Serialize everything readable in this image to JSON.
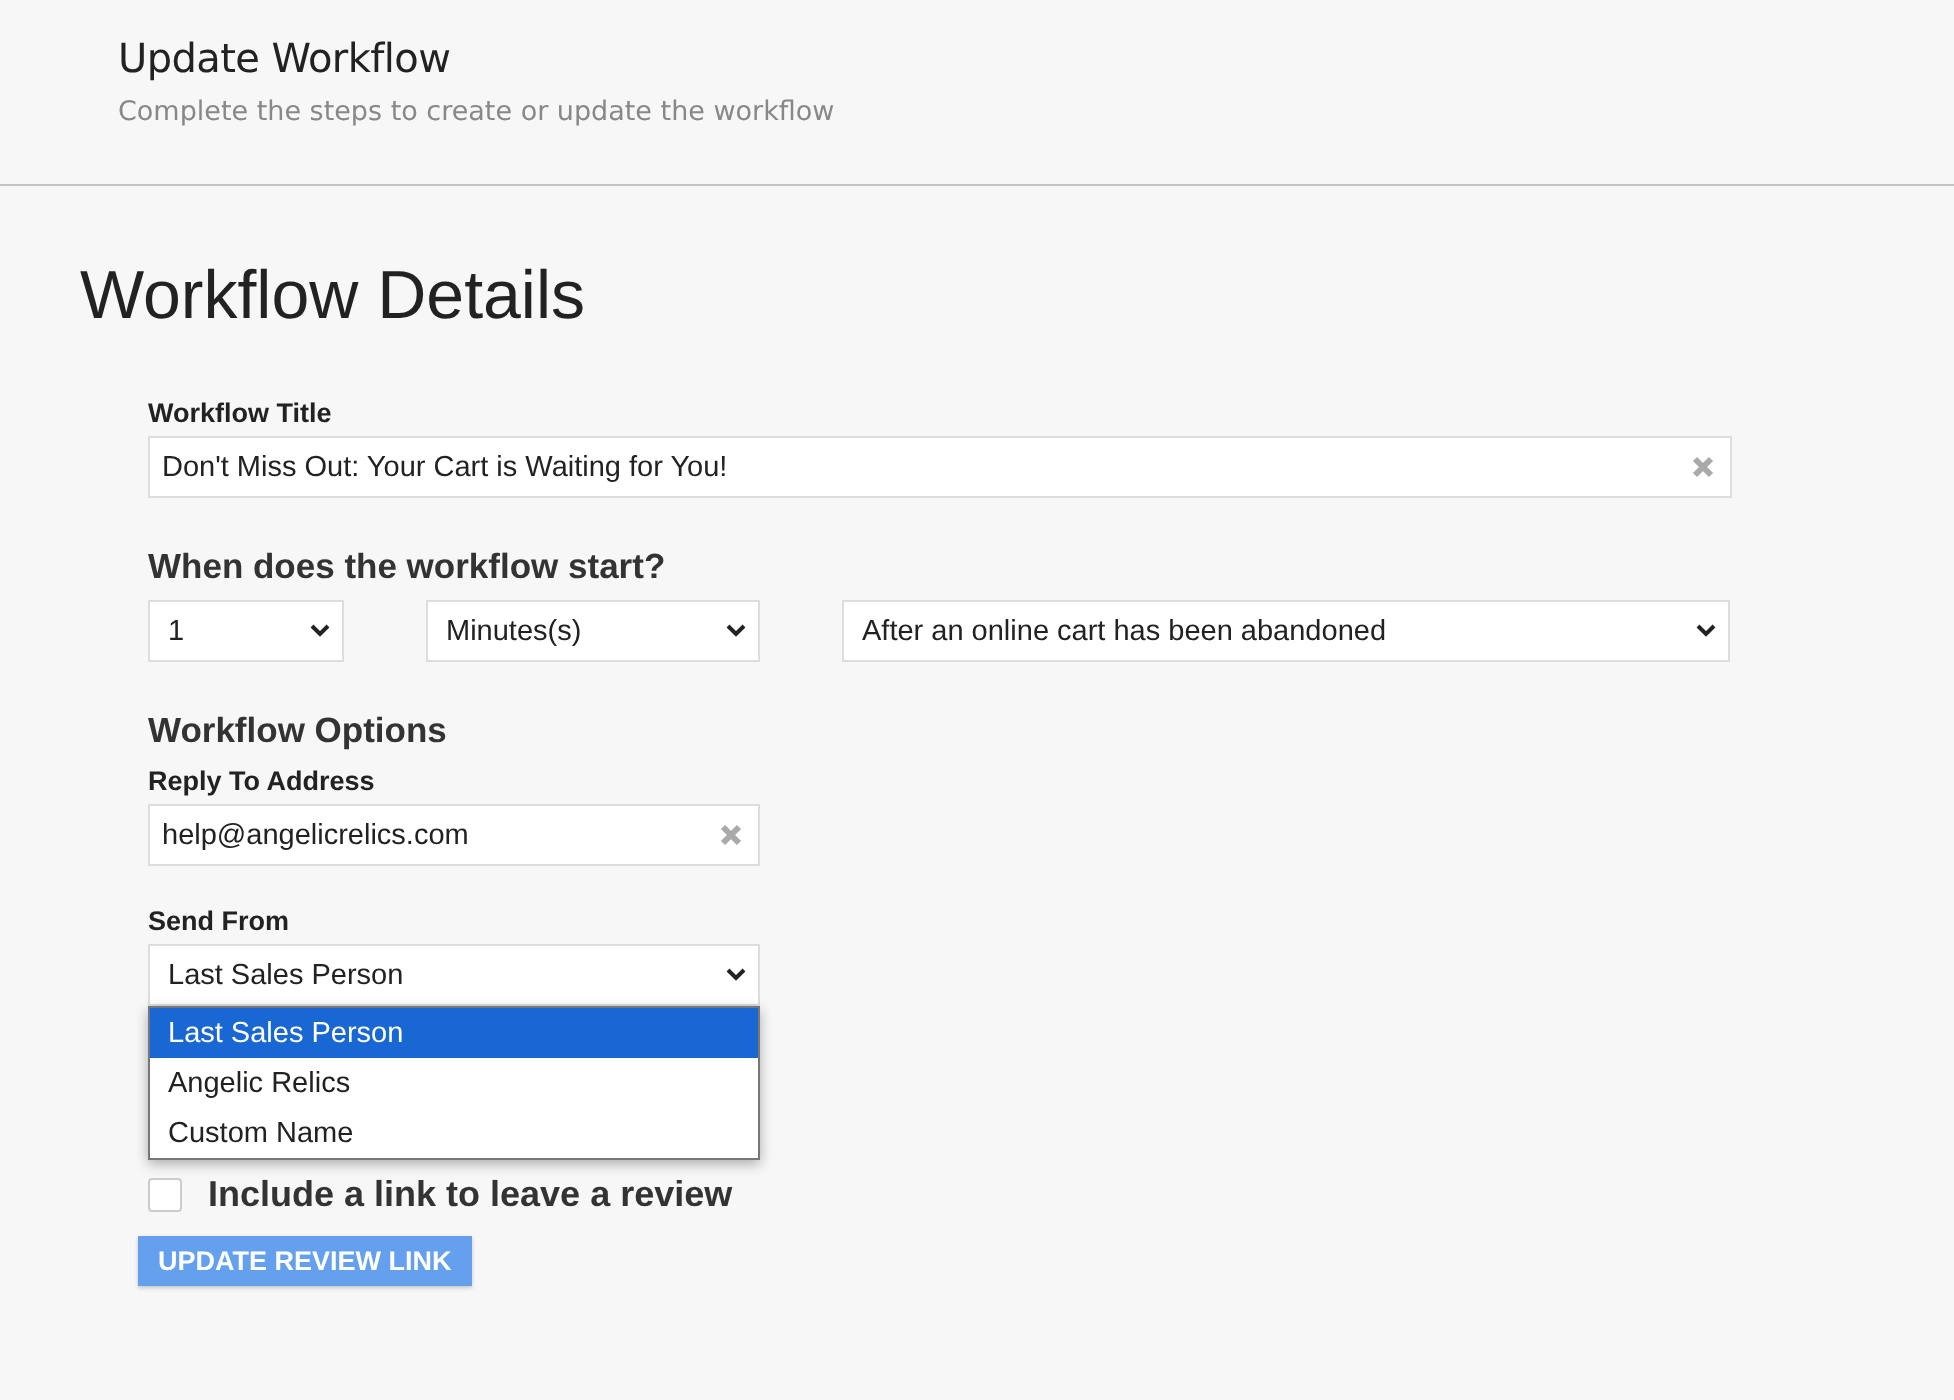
{
  "header": {
    "title": "Update Workflow",
    "subtitle": "Complete the steps to create or update the workflow"
  },
  "section_title": "Workflow Details",
  "workflow_title": {
    "label": "Workflow Title",
    "value": "Don't Miss Out: Your Cart is Waiting for You!"
  },
  "start": {
    "heading": "When does the workflow start?",
    "selects": [
      {
        "value": "1"
      },
      {
        "value": "Minutes(s)"
      },
      {
        "value": "After an online cart has been abandoned"
      }
    ]
  },
  "options": {
    "heading": "Workflow Options",
    "reply_to": {
      "label": "Reply To Address",
      "value": "help@angelicrelics.com"
    },
    "send_from": {
      "label": "Send From",
      "value": "Last Sales Person",
      "expanded": true,
      "options": [
        {
          "label": "Last Sales Person",
          "selected": true
        },
        {
          "label": "Angelic Relics",
          "selected": false
        },
        {
          "label": "Custom Name",
          "selected": false
        }
      ]
    },
    "review_link": {
      "label": "Include a link to leave a review",
      "checked": false
    },
    "button": "UPDATE REVIEW LINK"
  }
}
